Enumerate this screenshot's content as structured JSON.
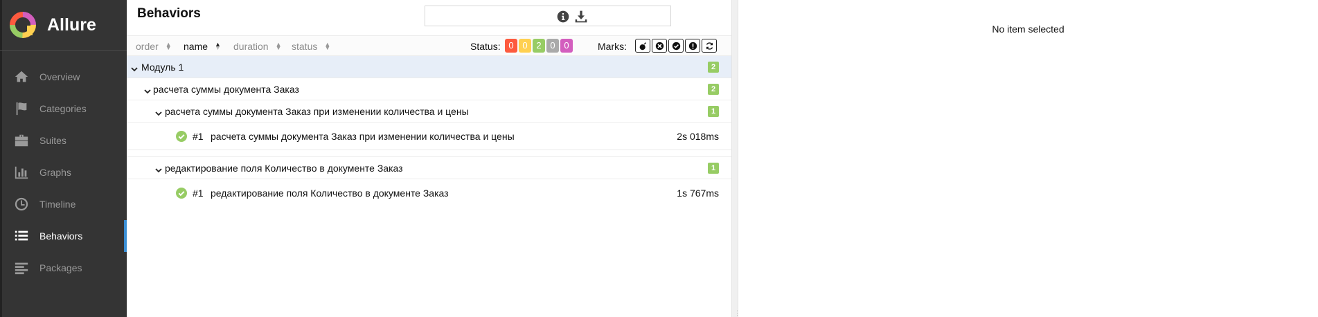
{
  "app": {
    "name": "Allure"
  },
  "sidebar": {
    "items": [
      {
        "label": "Overview",
        "icon": "home-icon"
      },
      {
        "label": "Categories",
        "icon": "flag-icon"
      },
      {
        "label": "Suites",
        "icon": "briefcase-icon"
      },
      {
        "label": "Graphs",
        "icon": "bar-chart-icon"
      },
      {
        "label": "Timeline",
        "icon": "clock-icon"
      },
      {
        "label": "Behaviors",
        "icon": "list-icon",
        "active": true
      },
      {
        "label": "Packages",
        "icon": "align-left-icon"
      }
    ]
  },
  "pane": {
    "title": "Behaviors",
    "search": {
      "value": "",
      "placeholder": ""
    }
  },
  "sortbar": {
    "order": "order",
    "name": "name",
    "duration": "duration",
    "status": "status",
    "active": "name",
    "status_label": "Status:",
    "status_counts": [
      {
        "value": "0",
        "color": "#fd5a3e"
      },
      {
        "value": "0",
        "color": "#ffd050"
      },
      {
        "value": "2",
        "color": "#97cc64"
      },
      {
        "value": "0",
        "color": "#aaaaaa"
      },
      {
        "value": "0",
        "color": "#d35ebe"
      }
    ],
    "marks_label": "Marks:"
  },
  "tree": {
    "epic": {
      "label": "Модуль 1",
      "count": "2"
    },
    "feature": {
      "label": "расчета суммы документа Заказ",
      "count": "2"
    },
    "stories": [
      {
        "label": "расчета суммы документа Заказ при изменении количества и цены",
        "count": "1",
        "test": {
          "num": "#1",
          "title": "расчета суммы документа Заказ при изменении количества и цены",
          "duration": "2s 018ms"
        }
      },
      {
        "label": "редактирование поля Количество в документе Заказ",
        "count": "1",
        "test": {
          "num": "#1",
          "title": "редактирование поля Количество в документе Заказ",
          "duration": "1s 767ms"
        }
      }
    ]
  },
  "detail": {
    "empty": "No item selected"
  },
  "colors": {
    "sidebar_bg": "#343434",
    "accent": "#3a8fd6",
    "passed": "#97cc64",
    "selected_row": "#e7eef8"
  }
}
